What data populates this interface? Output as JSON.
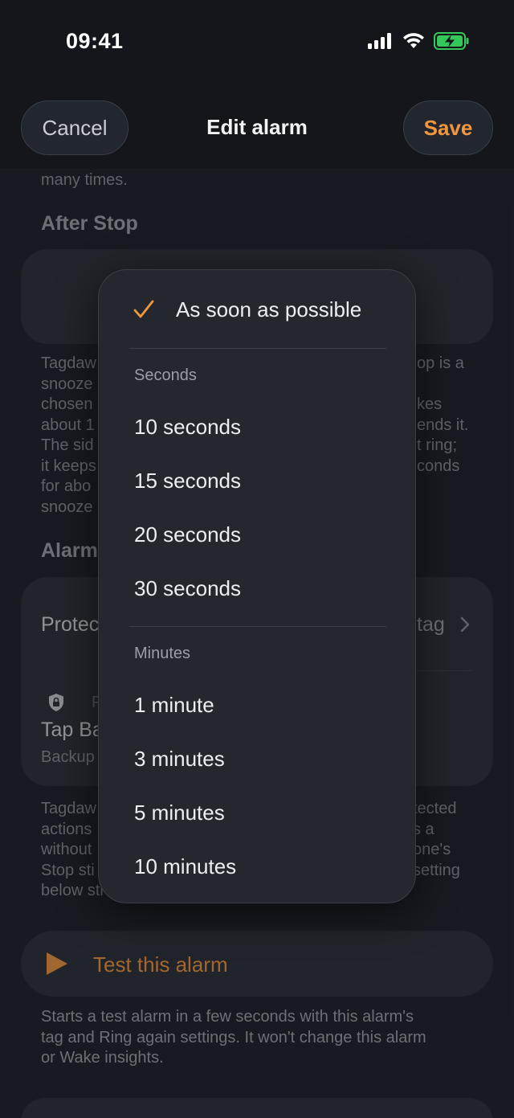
{
  "status_bar": {
    "time": "09:41"
  },
  "header": {
    "title": "Edit alarm",
    "cancel_label": "Cancel",
    "save_label": "Save"
  },
  "background": {
    "top_fragment": "many times.",
    "after_stop_title": "After Stop",
    "desc_left": [
      "Tagdaw",
      "snooze",
      "chosen",
      "about 1",
      "The sid",
      "it keeps",
      "for abo",
      "snooze"
    ],
    "desc_right": [
      "op is a",
      "",
      "kes",
      "ends it.",
      "t ring;",
      "conds"
    ],
    "alarm_title": "Alarm",
    "protect_label": "Protec",
    "protect_value": "tag",
    "tap_label": "Tap Ba",
    "backup_label": "Backup",
    "p_label": "P",
    "desc2_left": [
      "Tagdaw",
      "actions",
      "without",
      "Stop sti",
      "below sti"
    ],
    "desc2_right": [
      "tected",
      "s a",
      "one's",
      "setting"
    ],
    "test_label": "Test this alarm",
    "test_desc": [
      "Starts a test alarm in a few seconds with this alarm's",
      "tag and Ring again settings. It won't change this alarm",
      "or Wake insights."
    ]
  },
  "menu": {
    "selected": "As soon as possible",
    "seconds_header": "Seconds",
    "seconds": [
      "10 seconds",
      "15 seconds",
      "20 seconds",
      "30 seconds"
    ],
    "minutes_header": "Minutes",
    "minutes": [
      "1 minute",
      "3 minutes",
      "5 minutes",
      "10 minutes"
    ]
  },
  "colors": {
    "accent": "#f0963f",
    "battery": "#34c759"
  }
}
